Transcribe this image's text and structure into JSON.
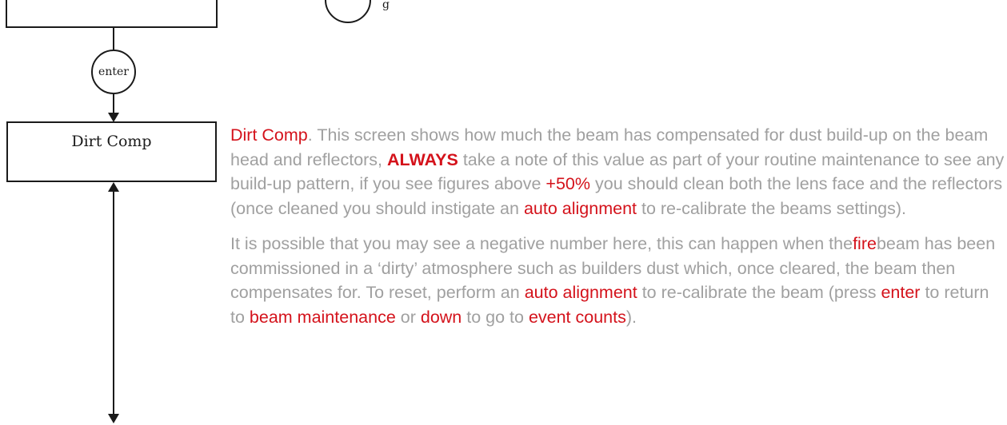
{
  "flow": {
    "top_circle_label": "g",
    "enter_label": "enter",
    "box_label": "Dirt Comp"
  },
  "text": {
    "p1": [
      {
        "t": "Dirt Comp",
        "s": "hl"
      },
      {
        "t": ". This screen shows how much the beam has compensated for dust build-up on the beam head and reflectors, ",
        "s": ""
      },
      {
        "t": "ALWAYS",
        "s": "strong"
      },
      {
        "t": " take a note of this value as part of your routine maintenance to see any build-up pattern, if you see figures above ",
        "s": ""
      },
      {
        "t": "+50%",
        "s": "hl"
      },
      {
        "t": " you should clean both the lens face and the reflectors (once cleaned you should instigate an ",
        "s": ""
      },
      {
        "t": "auto alignment",
        "s": "hl"
      },
      {
        "t": " to re-calibrate the beams settings).",
        "s": ""
      }
    ],
    "p2": [
      {
        "t": "It is possible that you may see a negative number here, this can happen when the",
        "s": ""
      },
      {
        "t": "fire",
        "s": "hl"
      },
      {
        "t": "beam has been commissioned in a ‘dirty’ atmosphere such as builders dust which, once cleared, the beam then compensates for. To reset, perform an ",
        "s": ""
      },
      {
        "t": "auto alignment",
        "s": "hl"
      },
      {
        "t": " to re-calibrate the beam (press ",
        "s": ""
      },
      {
        "t": "enter",
        "s": "hl"
      },
      {
        "t": " to return to ",
        "s": ""
      },
      {
        "t": "beam maintenance",
        "s": "hl"
      },
      {
        "t": " or ",
        "s": ""
      },
      {
        "t": "down",
        "s": "hl"
      },
      {
        "t": " to go to ",
        "s": ""
      },
      {
        "t": "event counts",
        "s": "hl"
      },
      {
        "t": ").",
        "s": ""
      }
    ]
  },
  "colors": {
    "body_text": "#a0a0a0",
    "highlight": "#d4121b",
    "line": "#1a1a1a"
  }
}
